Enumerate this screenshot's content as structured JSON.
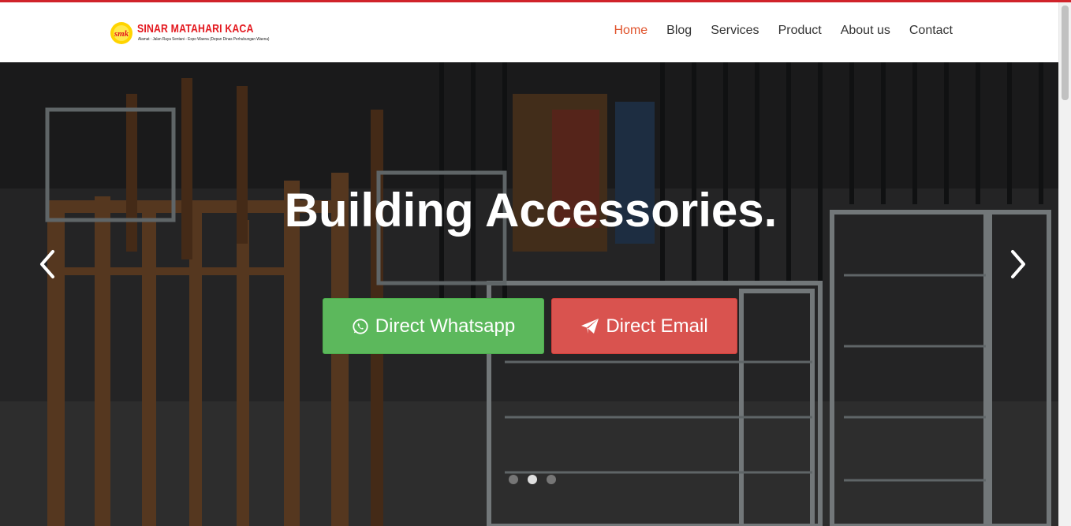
{
  "brand": {
    "name": "SINAR MATAHARI KACA",
    "monogram": "smk",
    "address": "Alamat : Jalan Raya Sentani - Expo Waena (Depan Dinas Perhubungan Waena)",
    "accent_color": "#e3171d"
  },
  "nav": {
    "items": [
      {
        "label": "Home",
        "active": true
      },
      {
        "label": "Blog"
      },
      {
        "label": "Services"
      },
      {
        "label": "Product"
      },
      {
        "label": "About us"
      },
      {
        "label": "Contact"
      }
    ],
    "active_color": "#e0532c"
  },
  "hero": {
    "title": "Building Accessories.",
    "buttons": {
      "whatsapp": {
        "label": "Direct Whatsapp",
        "icon": "whatsapp-icon",
        "color": "#5cb85c"
      },
      "email": {
        "label": "Direct Email",
        "icon": "paper-plane-icon",
        "color": "#d9534f"
      }
    },
    "carousel": {
      "slide_count": 3,
      "active_slide": 2,
      "prev_icon": "chevron-left-icon",
      "next_icon": "chevron-right-icon"
    }
  }
}
